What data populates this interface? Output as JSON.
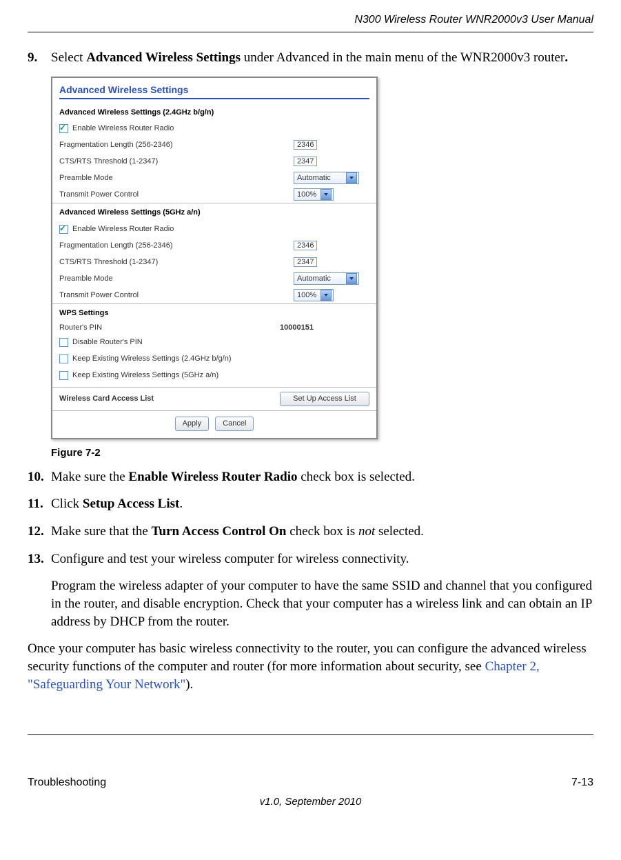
{
  "header": {
    "doc_title": "N300 Wireless Router WNR2000v3 User Manual"
  },
  "steps": {
    "s9_num": "9.",
    "s9_a": "Select ",
    "s9_b": "Advanced Wireless Settings",
    "s9_c": " under Advanced in the main menu of the WNR2000v3 router",
    "s9_d": ".",
    "s10_num": "10.",
    "s10_a": "Make sure the ",
    "s10_b": "Enable Wireless Router Radio",
    "s10_c": " check box is selected.",
    "s11_num": "11.",
    "s11_a": "Click ",
    "s11_b": "Setup Access List",
    "s11_c": ".",
    "s12_num": "12.",
    "s12_a": "Make sure that the ",
    "s12_b": "Turn Access Control On",
    "s12_c": " check box is ",
    "s12_d": "not",
    "s12_e": " selected.",
    "s13_num": "13.",
    "s13_a": "Configure and test your wireless computer for wireless connectivity.",
    "s13_sub": "Program the wireless adapter of your computer to have the same SSID and channel that you configured in the router, and disable encryption. Check that your computer has a wireless link and can obtain an IP address by DHCP from the router."
  },
  "closing": {
    "a": "Once your computer has basic wireless connectivity to the router, you can configure the advanced wireless security functions of the computer and router (for more information about security, see ",
    "link": "Chapter 2, \"Safeguarding Your Network\"",
    "b": ")."
  },
  "figure": {
    "caption": "Figure 7-2"
  },
  "shot": {
    "title": "Advanced Wireless Settings",
    "sec24_head": "Advanced Wireless Settings (2.4GHz b/g/n)",
    "sec5_head": "Advanced Wireless Settings (5GHz a/n)",
    "enable_radio": "Enable Wireless Router Radio",
    "frag_label": "Fragmentation Length (256-2346)",
    "frag_val": "2346",
    "cts_label": "CTS/RTS Threshold (1-2347)",
    "cts_val": "2347",
    "preamble_label": "Preamble Mode",
    "preamble_val": "Automatic",
    "txpower_label": "Transmit Power Control",
    "txpower_val": "100%",
    "wps_head": "WPS Settings",
    "pin_label": "Router's PIN",
    "pin_val": "10000151",
    "disable_pin": "Disable Router's PIN",
    "keep24": "Keep Existing Wireless Settings (2.4GHz b/g/n)",
    "keep5": "Keep Existing Wireless Settings (5GHz a/n)",
    "access_label": "Wireless Card Access List",
    "access_btn": "Set Up Access List",
    "apply": "Apply",
    "cancel": "Cancel"
  },
  "footer": {
    "section": "Troubleshooting",
    "page": "7-13",
    "version": "v1.0, September 2010"
  }
}
